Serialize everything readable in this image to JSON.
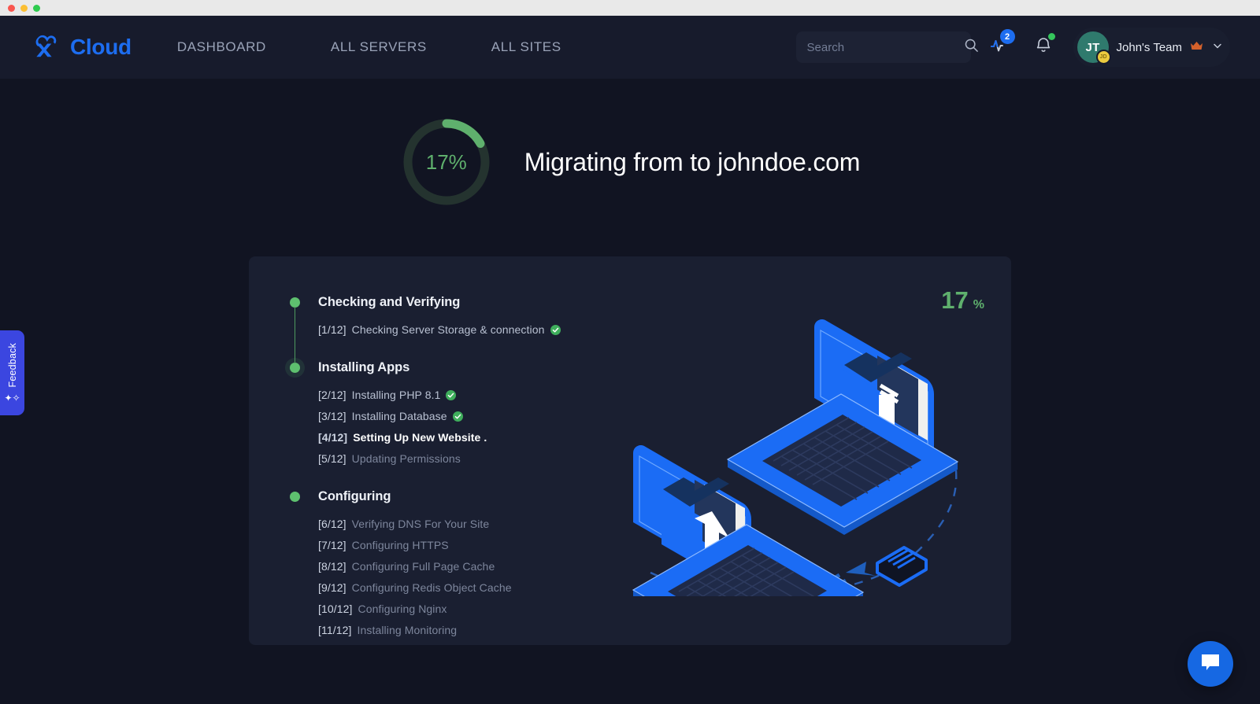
{
  "window": {
    "traffic_lights": [
      "close",
      "minimize",
      "maximize"
    ]
  },
  "header": {
    "brand": "Cloud",
    "brand_color": "#1d6df0",
    "nav": [
      {
        "label": "DASHBOARD"
      },
      {
        "label": "ALL SERVERS"
      },
      {
        "label": "ALL SITES"
      }
    ],
    "search": {
      "placeholder": "Search",
      "value": ""
    },
    "activity": {
      "badge": "2"
    },
    "notifications": {
      "has_unread": true
    },
    "user": {
      "initials": "JT",
      "sub_initials": "JD",
      "name": "John's Team",
      "crown": "♛"
    }
  },
  "hero": {
    "percent_label": "17%",
    "percent_value": 17,
    "title": "Migrating from to johndoe.com",
    "ring_track_color": "#24332f",
    "ring_arc_color": "#5fb06d"
  },
  "card": {
    "percent_number": "17",
    "percent_symbol": "%",
    "groups": [
      {
        "title": "Checking and Verifying",
        "tasks": [
          {
            "index": "[1/12]",
            "label": "Checking Server Storage & connection",
            "state": "done"
          }
        ]
      },
      {
        "title": "Installing Apps",
        "tasks": [
          {
            "index": "[2/12]",
            "label": "Installing PHP 8.1",
            "state": "done"
          },
          {
            "index": "[3/12]",
            "label": "Installing Database",
            "state": "done"
          },
          {
            "index": "[4/12]",
            "label": "Setting Up New Website .",
            "state": "active"
          },
          {
            "index": "[5/12]",
            "label": "Updating Permissions",
            "state": "pending"
          }
        ]
      },
      {
        "title": "Configuring",
        "tasks": [
          {
            "index": "[6/12]",
            "label": "Verifying DNS For Your Site",
            "state": "pending"
          },
          {
            "index": "[7/12]",
            "label": "Configuring HTTPS",
            "state": "pending"
          },
          {
            "index": "[8/12]",
            "label": "Configuring Full Page Cache",
            "state": "pending"
          },
          {
            "index": "[9/12]",
            "label": "Configuring Redis Object Cache",
            "state": "pending"
          },
          {
            "index": "[10/12]",
            "label": "Configuring Nginx",
            "state": "pending"
          },
          {
            "index": "[11/12]",
            "label": "Installing Monitoring",
            "state": "pending"
          }
        ]
      }
    ]
  },
  "feedback": {
    "label": "Feedback"
  },
  "chat": {
    "label": ""
  },
  "colors": {
    "page_bg": "#111422",
    "header_bg": "#171b2c",
    "card_bg": "#1a1f31",
    "accent_blue": "#1d6df0",
    "accent_green": "#5ec06f",
    "feedback_purple": "#3b46e0"
  }
}
